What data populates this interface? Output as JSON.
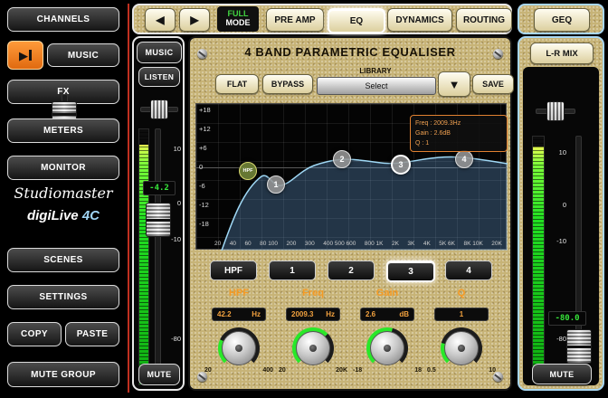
{
  "sidebar": {
    "buttons": {
      "channels": "CHANNELS",
      "music": "MUSIC",
      "fx": "FX",
      "meters": "METERS",
      "monitor": "MONITOR",
      "scenes": "SCENES",
      "settings": "SETTINGS",
      "copy": "COPY",
      "paste": "PASTE",
      "mute_group": "MUTE GROUP"
    },
    "logo_primary": "Studiomaster",
    "logo_secondary": "digiLive",
    "logo_model": "4C"
  },
  "icons": {
    "left_arrow": "◀",
    "right_arrow": "▶",
    "play": "▶",
    "dropdown_arrow": "▼"
  },
  "topbar": {
    "full": "FULL",
    "mode": "MODE",
    "preamp": "PRE AMP",
    "eq": "EQ",
    "dynamics": "DYNAMICS",
    "routing": "ROUTING",
    "selected_tab": "EQ"
  },
  "left_strip": {
    "label": "MUSIC",
    "listen": "LISTEN",
    "value": "-4.2",
    "mute": "MUTE",
    "scale": [
      "10",
      "0",
      "-10",
      "-80"
    ]
  },
  "right_panel": {
    "geq": "GEQ",
    "lr_mix": "L-R MIX",
    "value": "-80.0",
    "mute": "MUTE",
    "scale": [
      "10",
      "0",
      "-10",
      "-80"
    ]
  },
  "eq_panel": {
    "title": "4 BAND PARAMETRIC EQUALISER",
    "flat": "FLAT",
    "bypass": "BYPASS",
    "library_label": "LIBRARY",
    "library_value": "Select",
    "save": "SAVE",
    "info_freq": "Freq : 2009.3Hz",
    "info_gain": "Gain : 2.6dB",
    "info_q": "Q : 1",
    "db_labels": [
      "+18",
      "+12",
      "+6",
      "0",
      "-6",
      "-12",
      "-18"
    ],
    "freq_labels": [
      "20",
      "40",
      "60",
      "80 100",
      "200",
      "300",
      "400 500 600",
      "800 1K",
      "2K",
      "3K",
      "4K",
      "5K 6K",
      "8K 10K",
      "20K"
    ],
    "points": {
      "hpf": "HPF",
      "p1": "1",
      "p2": "2",
      "p3": "3",
      "p4": "4"
    },
    "bands": [
      {
        "label": "HPF",
        "selected": false
      },
      {
        "label": "1",
        "selected": false
      },
      {
        "label": "2",
        "selected": false
      },
      {
        "label": "3",
        "selected": true
      },
      {
        "label": "4",
        "selected": false
      }
    ],
    "knobs": [
      {
        "label": "HPF",
        "value": "42.2",
        "unit": "Hz",
        "min": "20",
        "max": "400"
      },
      {
        "label": "Freq",
        "value": "2009.3",
        "unit": "Hz",
        "min": "20",
        "max": "20K"
      },
      {
        "label": "Gain",
        "value": "2.6",
        "unit": "dB",
        "min": "-18",
        "max": "18"
      },
      {
        "label": "Q",
        "value": "1",
        "unit": "",
        "min": "0.5",
        "max": "10"
      }
    ]
  },
  "colors": {
    "gold": "#c7b377",
    "accent_orange": "#f59a23",
    "meter_green": "#22e022",
    "value_green": "#37e53a",
    "right_border_blue": "#a9d7f2",
    "transport_orange": "#f07818"
  }
}
